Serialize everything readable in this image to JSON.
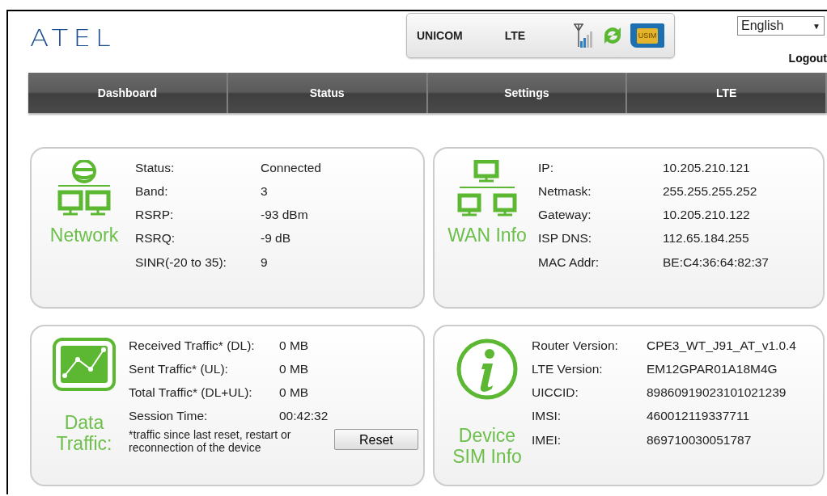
{
  "header": {
    "logo": "ATEL",
    "carrier": "UNICOM",
    "network_type": "LTE",
    "sim_label": "USIM",
    "language": "English",
    "language_caret": "▼",
    "logout": "Logout"
  },
  "tabs": [
    {
      "label": "Dashboard",
      "selected": false
    },
    {
      "label": "Status",
      "selected": false
    },
    {
      "label": "Settings",
      "selected": false
    },
    {
      "label": "LTE",
      "selected": false
    }
  ],
  "panels": [
    {
      "kind": "network",
      "title": "Network",
      "rows": [
        {
          "label": "Status:",
          "value": "Connected"
        },
        {
          "label": "Band:",
          "value": "3"
        },
        {
          "label": "RSRP:",
          "value": "-93 dBm"
        },
        {
          "label": "RSRQ:",
          "value": "-9 dB"
        },
        {
          "label": "SINR(-20 to 35):",
          "value": "9"
        }
      ]
    },
    {
      "kind": "wan",
      "title": "WAN Info",
      "rows": [
        {
          "label": "IP:",
          "value": "10.205.210.121"
        },
        {
          "label": "Netmask:",
          "value": "255.255.255.252"
        },
        {
          "label": "Gateway:",
          "value": "10.205.210.122"
        },
        {
          "label": "ISP DNS:",
          "value": "112.65.184.255"
        },
        {
          "label": "MAC Addr:",
          "value": "BE:C4:36:64:82:37"
        }
      ]
    },
    {
      "kind": "traffic",
      "title": "Data Traffic:",
      "rows": [
        {
          "label": "Received Traffic* (DL):",
          "value": "0 MB"
        },
        {
          "label": "Sent Traffic* (UL):",
          "value": "0 MB"
        },
        {
          "label": "Total Traffic* (DL+UL):",
          "value": "0 MB"
        },
        {
          "label": "Session Time:",
          "value": "00:42:32"
        }
      ],
      "note": "*traffic since last reset, restart or reconnection of the device",
      "button": "Reset"
    },
    {
      "kind": "device",
      "title": "Device SIM Info",
      "rows": [
        {
          "label": "Router Version:",
          "value": "CPE3_WT_J91_AT_v1.0.4"
        },
        {
          "label": "LTE Version:",
          "value": "EM12GPAR01A18M4G"
        },
        {
          "label": "UICCID:",
          "value": "89860919023101021239"
        },
        {
          "label": "IMSI:",
          "value": "460012119337711"
        },
        {
          "label": "IMEI:",
          "value": "869710030051787"
        }
      ]
    }
  ]
}
